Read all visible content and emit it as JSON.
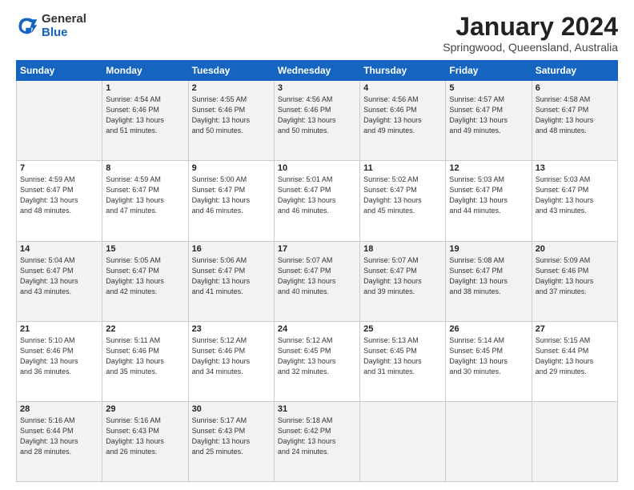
{
  "logo": {
    "general": "General",
    "blue": "Blue"
  },
  "title": "January 2024",
  "subtitle": "Springwood, Queensland, Australia",
  "weekdays": [
    "Sunday",
    "Monday",
    "Tuesday",
    "Wednesday",
    "Thursday",
    "Friday",
    "Saturday"
  ],
  "weeks": [
    [
      {
        "day": null,
        "info": null
      },
      {
        "day": "1",
        "sunrise": "4:54 AM",
        "sunset": "6:46 PM",
        "daylight": "13 hours and 51 minutes."
      },
      {
        "day": "2",
        "sunrise": "4:55 AM",
        "sunset": "6:46 PM",
        "daylight": "13 hours and 50 minutes."
      },
      {
        "day": "3",
        "sunrise": "4:56 AM",
        "sunset": "6:46 PM",
        "daylight": "13 hours and 50 minutes."
      },
      {
        "day": "4",
        "sunrise": "4:56 AM",
        "sunset": "6:46 PM",
        "daylight": "13 hours and 49 minutes."
      },
      {
        "day": "5",
        "sunrise": "4:57 AM",
        "sunset": "6:47 PM",
        "daylight": "13 hours and 49 minutes."
      },
      {
        "day": "6",
        "sunrise": "4:58 AM",
        "sunset": "6:47 PM",
        "daylight": "13 hours and 48 minutes."
      }
    ],
    [
      {
        "day": "7",
        "sunrise": "4:59 AM",
        "sunset": "6:47 PM",
        "daylight": "13 hours and 48 minutes."
      },
      {
        "day": "8",
        "sunrise": "4:59 AM",
        "sunset": "6:47 PM",
        "daylight": "13 hours and 47 minutes."
      },
      {
        "day": "9",
        "sunrise": "5:00 AM",
        "sunset": "6:47 PM",
        "daylight": "13 hours and 46 minutes."
      },
      {
        "day": "10",
        "sunrise": "5:01 AM",
        "sunset": "6:47 PM",
        "daylight": "13 hours and 46 minutes."
      },
      {
        "day": "11",
        "sunrise": "5:02 AM",
        "sunset": "6:47 PM",
        "daylight": "13 hours and 45 minutes."
      },
      {
        "day": "12",
        "sunrise": "5:03 AM",
        "sunset": "6:47 PM",
        "daylight": "13 hours and 44 minutes."
      },
      {
        "day": "13",
        "sunrise": "5:03 AM",
        "sunset": "6:47 PM",
        "daylight": "13 hours and 43 minutes."
      }
    ],
    [
      {
        "day": "14",
        "sunrise": "5:04 AM",
        "sunset": "6:47 PM",
        "daylight": "13 hours and 43 minutes."
      },
      {
        "day": "15",
        "sunrise": "5:05 AM",
        "sunset": "6:47 PM",
        "daylight": "13 hours and 42 minutes."
      },
      {
        "day": "16",
        "sunrise": "5:06 AM",
        "sunset": "6:47 PM",
        "daylight": "13 hours and 41 minutes."
      },
      {
        "day": "17",
        "sunrise": "5:07 AM",
        "sunset": "6:47 PM",
        "daylight": "13 hours and 40 minutes."
      },
      {
        "day": "18",
        "sunrise": "5:07 AM",
        "sunset": "6:47 PM",
        "daylight": "13 hours and 39 minutes."
      },
      {
        "day": "19",
        "sunrise": "5:08 AM",
        "sunset": "6:47 PM",
        "daylight": "13 hours and 38 minutes."
      },
      {
        "day": "20",
        "sunrise": "5:09 AM",
        "sunset": "6:46 PM",
        "daylight": "13 hours and 37 minutes."
      }
    ],
    [
      {
        "day": "21",
        "sunrise": "5:10 AM",
        "sunset": "6:46 PM",
        "daylight": "13 hours and 36 minutes."
      },
      {
        "day": "22",
        "sunrise": "5:11 AM",
        "sunset": "6:46 PM",
        "daylight": "13 hours and 35 minutes."
      },
      {
        "day": "23",
        "sunrise": "5:12 AM",
        "sunset": "6:46 PM",
        "daylight": "13 hours and 34 minutes."
      },
      {
        "day": "24",
        "sunrise": "5:12 AM",
        "sunset": "6:45 PM",
        "daylight": "13 hours and 32 minutes."
      },
      {
        "day": "25",
        "sunrise": "5:13 AM",
        "sunset": "6:45 PM",
        "daylight": "13 hours and 31 minutes."
      },
      {
        "day": "26",
        "sunrise": "5:14 AM",
        "sunset": "6:45 PM",
        "daylight": "13 hours and 30 minutes."
      },
      {
        "day": "27",
        "sunrise": "5:15 AM",
        "sunset": "6:44 PM",
        "daylight": "13 hours and 29 minutes."
      }
    ],
    [
      {
        "day": "28",
        "sunrise": "5:16 AM",
        "sunset": "6:44 PM",
        "daylight": "13 hours and 28 minutes."
      },
      {
        "day": "29",
        "sunrise": "5:16 AM",
        "sunset": "6:43 PM",
        "daylight": "13 hours and 26 minutes."
      },
      {
        "day": "30",
        "sunrise": "5:17 AM",
        "sunset": "6:43 PM",
        "daylight": "13 hours and 25 minutes."
      },
      {
        "day": "31",
        "sunrise": "5:18 AM",
        "sunset": "6:42 PM",
        "daylight": "13 hours and 24 minutes."
      },
      {
        "day": null,
        "info": null
      },
      {
        "day": null,
        "info": null
      },
      {
        "day": null,
        "info": null
      }
    ]
  ]
}
